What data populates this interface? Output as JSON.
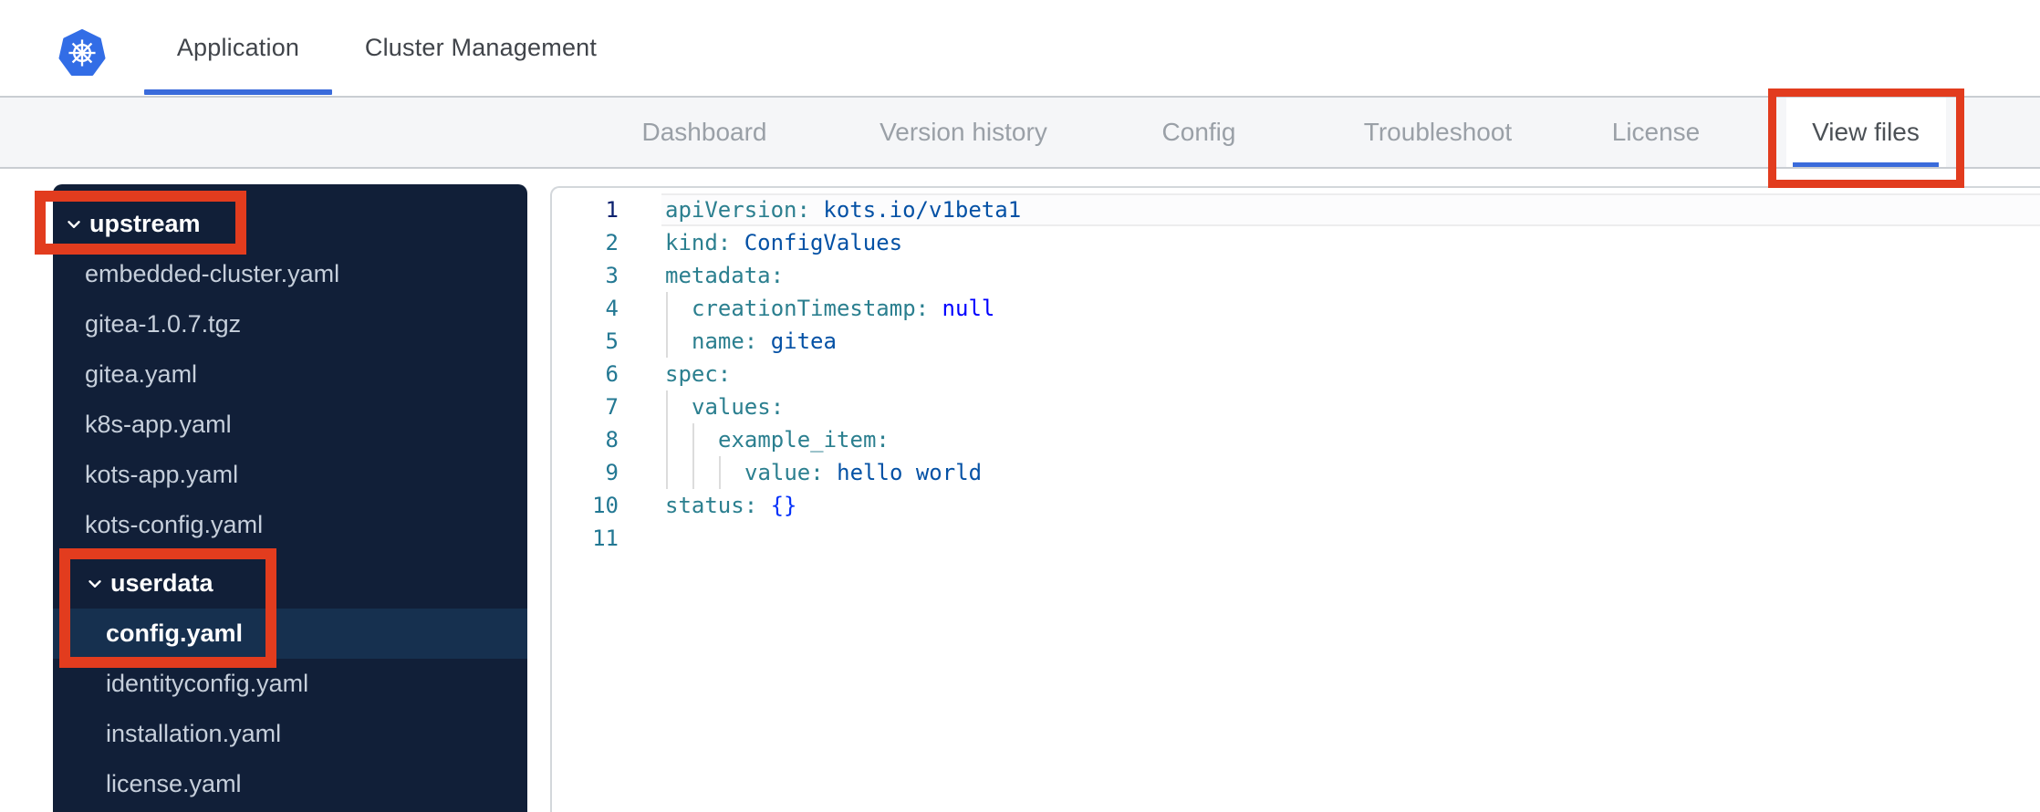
{
  "header": {
    "logo": "kubernetes-logo",
    "tabs": [
      {
        "label": "Application",
        "active": true
      },
      {
        "label": "Cluster Management",
        "active": false
      }
    ]
  },
  "subnav": {
    "items": [
      {
        "label": "Dashboard",
        "active": false
      },
      {
        "label": "Version history",
        "active": false
      },
      {
        "label": "Config",
        "active": false
      },
      {
        "label": "Troubleshoot",
        "active": false
      },
      {
        "label": "License",
        "active": false
      },
      {
        "label": "View files",
        "active": true
      }
    ]
  },
  "file_tree": {
    "items": [
      {
        "label": "upstream",
        "kind": "folder",
        "level": 0,
        "expanded": true,
        "annotated": true
      },
      {
        "label": "embedded-cluster.yaml",
        "kind": "file",
        "level": 1
      },
      {
        "label": "gitea-1.0.7.tgz",
        "kind": "file",
        "level": 1
      },
      {
        "label": "gitea.yaml",
        "kind": "file",
        "level": 1
      },
      {
        "label": "k8s-app.yaml",
        "kind": "file",
        "level": 1
      },
      {
        "label": "kots-app.yaml",
        "kind": "file",
        "level": 1
      },
      {
        "label": "kots-config.yaml",
        "kind": "file",
        "level": 1
      },
      {
        "label": "userdata",
        "kind": "folder",
        "level": 1,
        "expanded": true,
        "annotated": true,
        "gap_before": true
      },
      {
        "label": "config.yaml",
        "kind": "file",
        "level": 2,
        "selected": true,
        "annotated": true
      },
      {
        "label": "identityconfig.yaml",
        "kind": "file",
        "level": 2
      },
      {
        "label": "installation.yaml",
        "kind": "file",
        "level": 2
      },
      {
        "label": "license.yaml",
        "kind": "file",
        "level": 2
      }
    ]
  },
  "editor": {
    "language": "yaml",
    "current_line": 1,
    "lines": [
      {
        "n": 1,
        "indent": 0,
        "key": "apiVersion",
        "value": "kots.io/v1beta1",
        "vtype": "str"
      },
      {
        "n": 2,
        "indent": 0,
        "key": "kind",
        "value": "ConfigValues",
        "vtype": "str"
      },
      {
        "n": 3,
        "indent": 0,
        "key": "metadata"
      },
      {
        "n": 4,
        "indent": 1,
        "key": "creationTimestamp",
        "value": "null",
        "vtype": "kw"
      },
      {
        "n": 5,
        "indent": 1,
        "key": "name",
        "value": "gitea",
        "vtype": "str"
      },
      {
        "n": 6,
        "indent": 0,
        "key": "spec"
      },
      {
        "n": 7,
        "indent": 1,
        "key": "values"
      },
      {
        "n": 8,
        "indent": 2,
        "key": "example_item"
      },
      {
        "n": 9,
        "indent": 3,
        "key": "value",
        "value": "hello world",
        "vtype": "str"
      },
      {
        "n": 10,
        "indent": 0,
        "key": "status",
        "value": "{}",
        "vtype": "bracket"
      },
      {
        "n": 11
      }
    ]
  },
  "annotations": {
    "color": "#e23c1e",
    "highlighted": [
      "view-files-tab",
      "upstream-folder",
      "userdata-and-config-yaml"
    ]
  },
  "colors": {
    "brand_blue": "#3a6bdb",
    "logo_blue": "#326de6",
    "sidebar_bg": "#111f38",
    "sidebar_selected": "#16304f",
    "annotation_red": "#e23c1e",
    "yaml_key": "#2b7f8f",
    "yaml_string": "#0451a5",
    "yaml_keyword": "#0000ff",
    "yaml_bracket": "#0431fa",
    "line_number": "#237893",
    "line_number_active": "#0b216f"
  }
}
